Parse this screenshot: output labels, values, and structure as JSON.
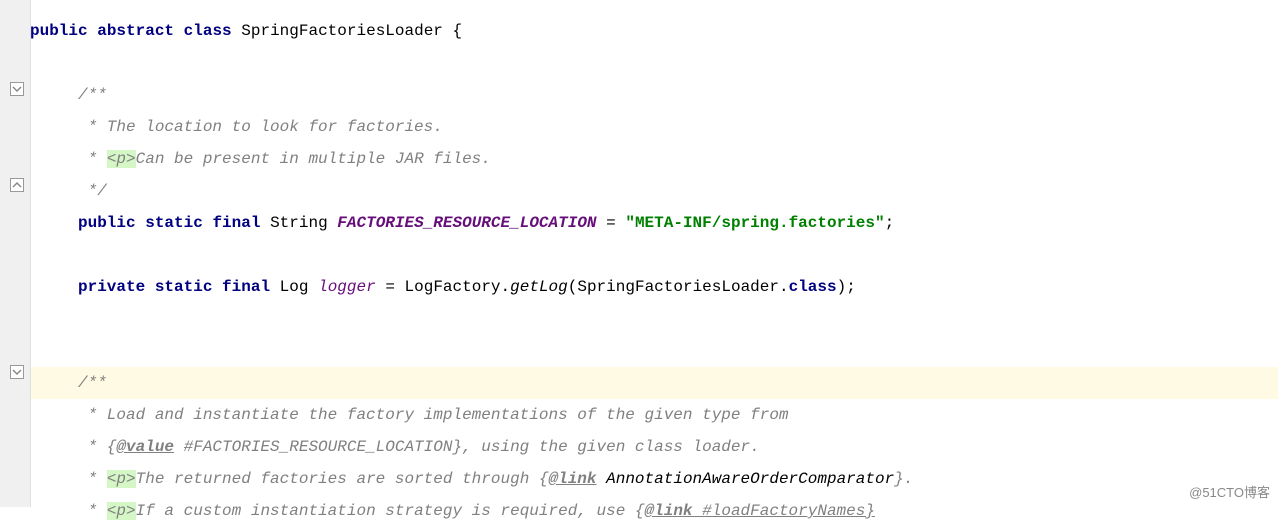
{
  "line1": {
    "kw_public": "public",
    "kw_abstract": "abstract",
    "kw_class": "class",
    "classname": "SpringFactoriesLoader",
    "brace": " {"
  },
  "comment1": {
    "l1": "/**",
    "l2": " * The location to look for factories.",
    "l3a": " * ",
    "l3tag": "<p>",
    "l3b": "Can be present in multiple JAR files.",
    "l4": " */"
  },
  "line_const": {
    "kw_public": "public",
    "kw_static": "static",
    "kw_final": "final",
    "type": "String",
    "name": "FACTORIES_RESOURCE_LOCATION",
    "eq": "= ",
    "value": "\"META-INF/spring.factories\"",
    "semi": ";"
  },
  "line_logger": {
    "kw_private": "private",
    "kw_static": "static",
    "kw_final": "final",
    "type": "Log",
    "name": "logger",
    "eq": "= ",
    "factory": "LogFactory.",
    "method": "getLog",
    "arg": "(SpringFactoriesLoader.",
    "kw_class": "class",
    "close": ");"
  },
  "comment2": {
    "l1": "/**",
    "l2": " * Load and instantiate the factory implementations of the given type from",
    "l3a": " * {",
    "l3tag": "@value",
    "l3b": " #FACTORIES_RESOURCE_LOCATION}, using the given class loader.",
    "l4a": " * ",
    "l4p": "<p>",
    "l4b": "The returned factories are sorted through {",
    "l4tag": "@link",
    "l4sp": " ",
    "l4cls": "AnnotationAwareOrderComparator",
    "l4c": "}.",
    "l5a": " * ",
    "l5p": "<p>",
    "l5b": "If a custom instantiation strategy is required, use {",
    "l5tag": "@link",
    "l5c": " #loadFactoryNames}"
  },
  "watermark": "@51CTO博客"
}
